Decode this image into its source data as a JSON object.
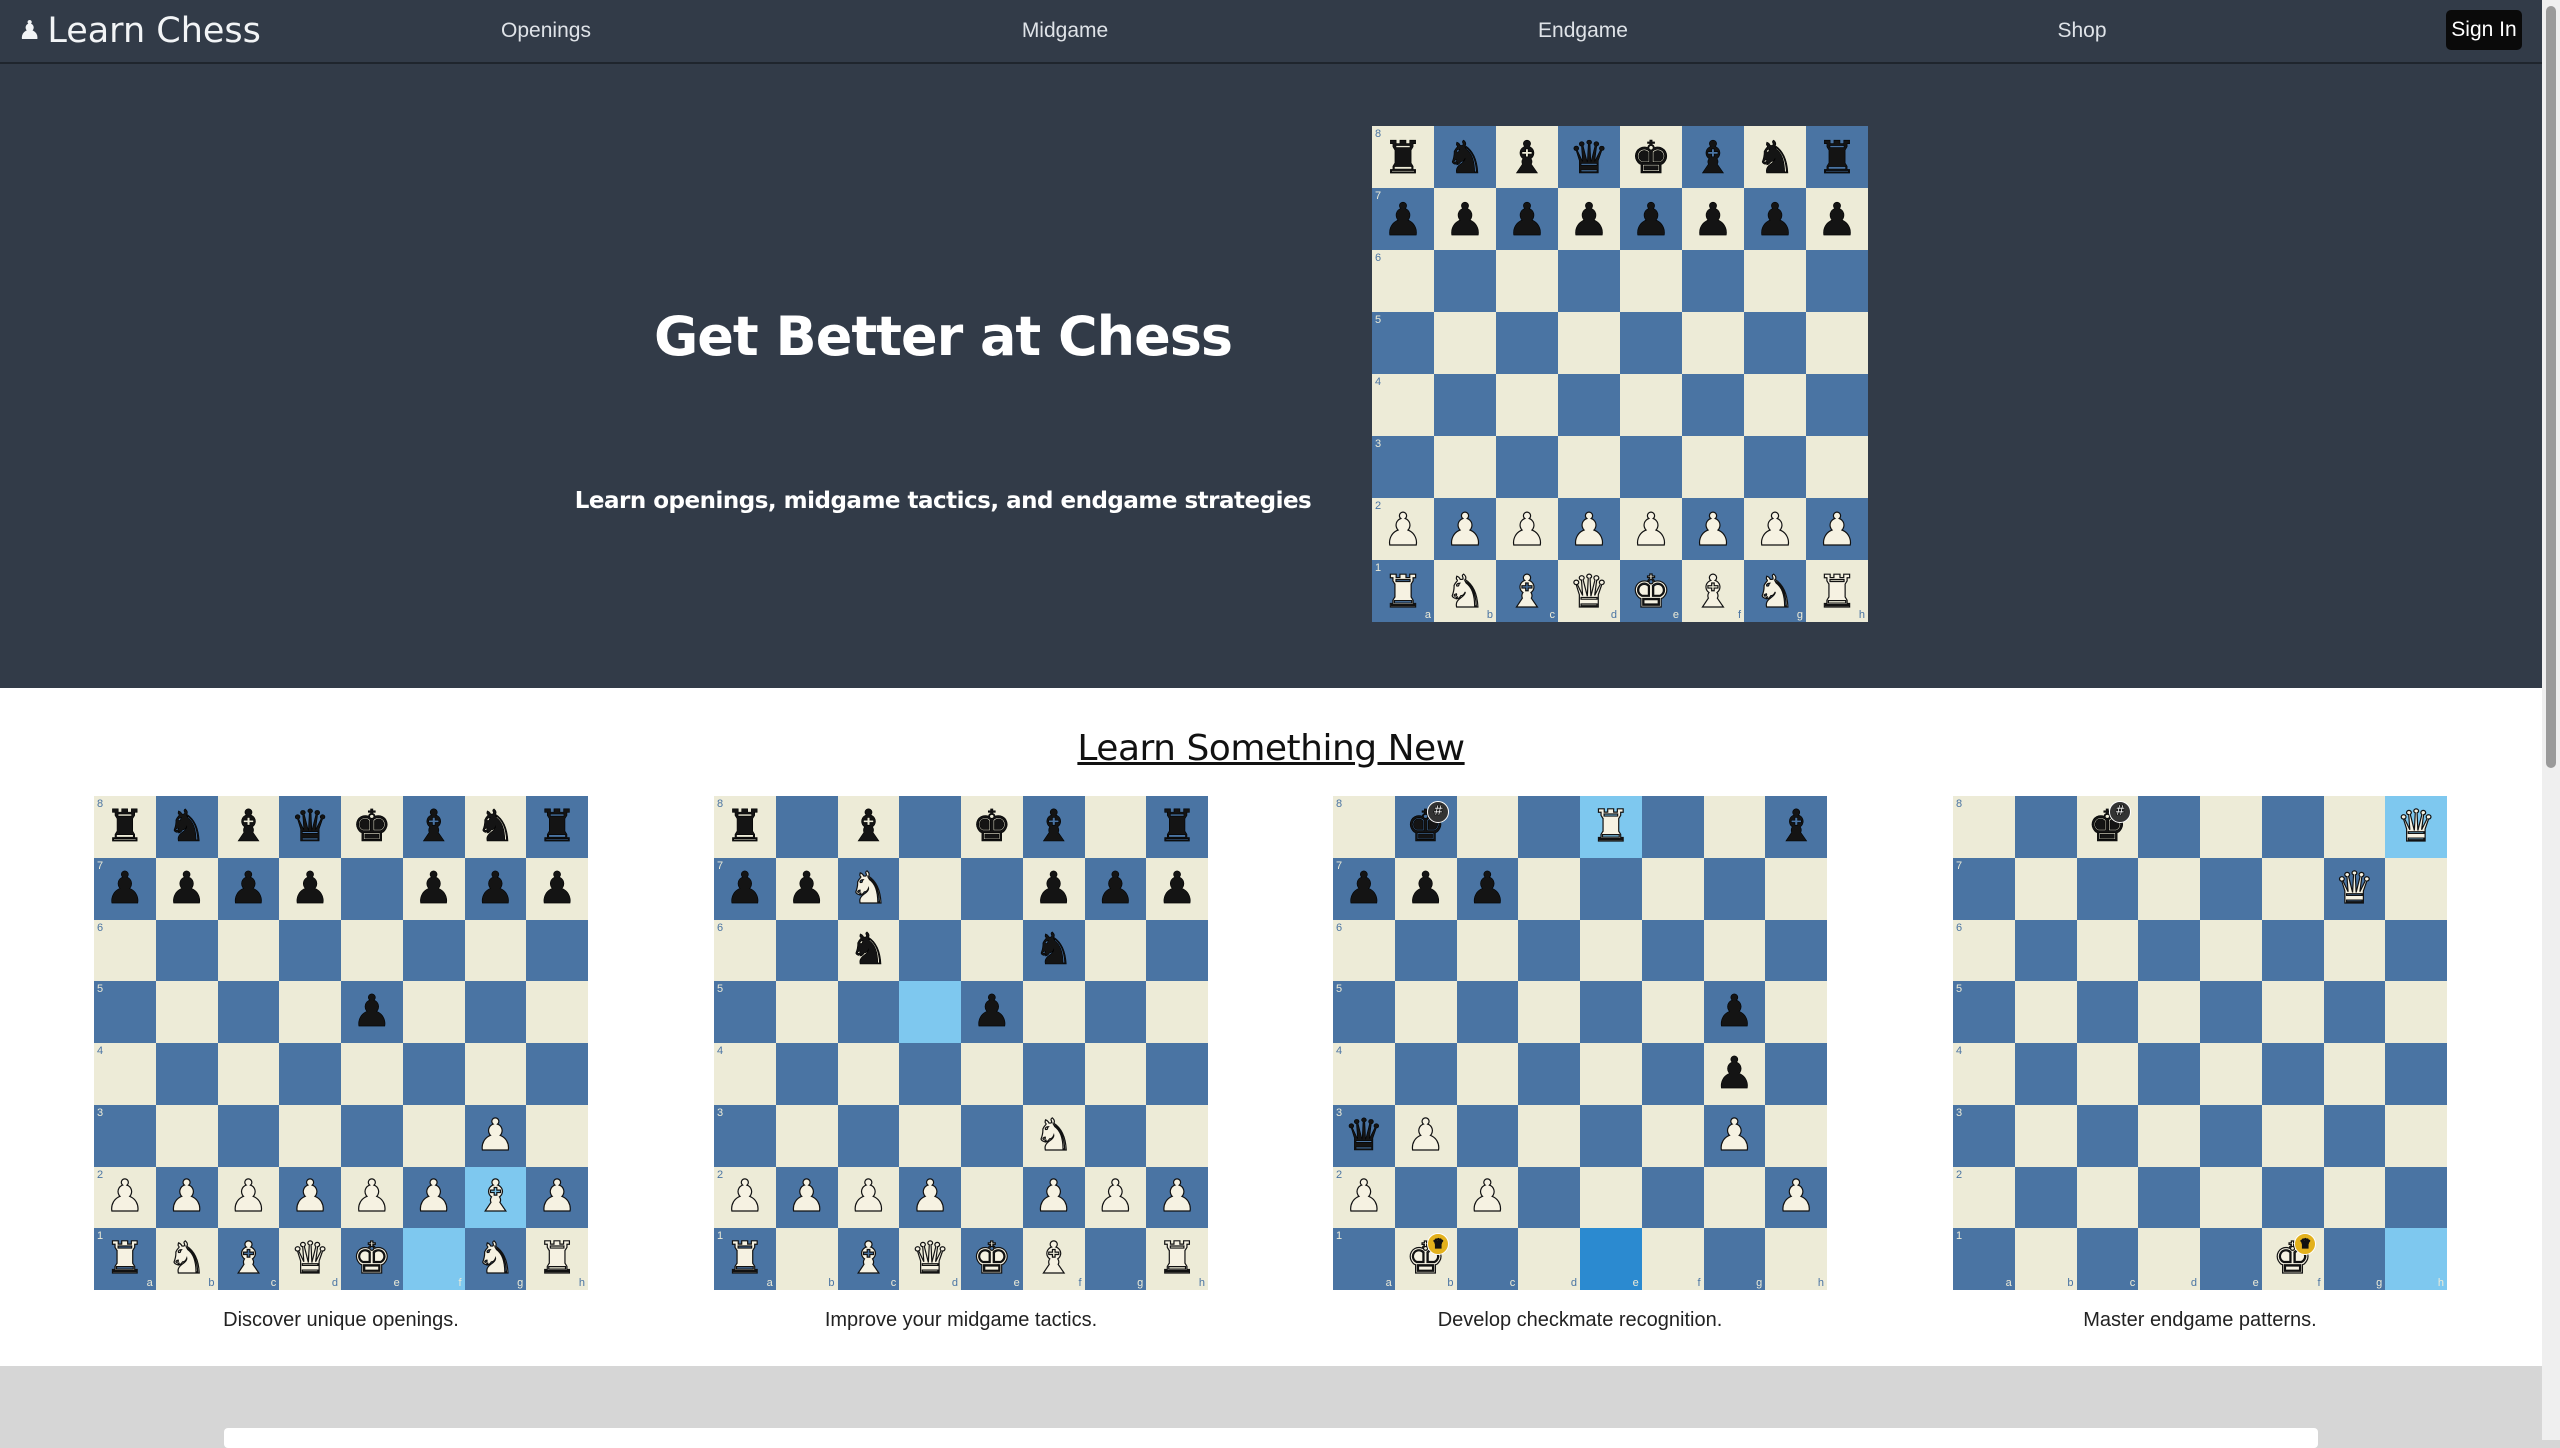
{
  "nav": {
    "brand_icon": "pawn-icon",
    "brand": "Learn Chess",
    "links": [
      "Openings",
      "Midgame",
      "Endgame",
      "Shop"
    ],
    "signin": "Sign In"
  },
  "hero": {
    "title": "Get Better at Chess",
    "subtitle": "Learn openings, midgame tactics, and endgame strategies"
  },
  "section": {
    "title": "Learn Something New"
  },
  "colors": {
    "nav_bg": "#323b48",
    "light_square": "#edebd7",
    "dark_square": "#4a74a3",
    "highlight": "#7ec8ef",
    "highlight_strong": "#2b8ad0",
    "mate_badge": "#333333",
    "win_badge": "#e3b11c"
  },
  "hero_board": {
    "rows": [
      "rnbqkbnr",
      "pppppppp",
      "........",
      "........",
      "........",
      "........",
      "PPPPPPPP",
      "RNBQKBNR"
    ],
    "highlights": {},
    "badges": {}
  },
  "cards": [
    {
      "caption": "Discover unique openings.",
      "rows": [
        "rnbqkbnr",
        "pppp.ppp",
        "........",
        "....p...",
        "........",
        "......P.",
        "PPPPPPBP",
        "RNBQK.NR"
      ],
      "highlights": {
        "6-6": "hl",
        "7-5": "hl"
      },
      "badges": {}
    },
    {
      "caption": "Improve your midgame tactics.",
      "rows": [
        "r.b.kb.r",
        "ppN..ppp",
        "..n..n..",
        "....p...",
        "........",
        ".....N..",
        "PPPP.PPP",
        "R.BQKB.R"
      ],
      "highlights": {
        "3-3": "hl"
      },
      "badges": {}
    },
    {
      "caption": "Develop checkmate recognition.",
      "rows": [
        ".k..R..b",
        "ppp.....",
        "........",
        "......p.",
        "......p.",
        "qP....P.",
        "P.P....P",
        ".K......"
      ],
      "highlights": {
        "0-4": "hl",
        "7-4": "hl2"
      },
      "badges": {
        "0-1": "mate",
        "7-1": "win"
      }
    },
    {
      "caption": "Master endgame patterns.",
      "rows": [
        "..k....Q",
        "......Q.",
        "........",
        "........",
        "........",
        "........",
        "........",
        ".....K.."
      ],
      "highlights": {
        "0-7": "hl",
        "7-7": "hl"
      },
      "badges": {
        "0-2": "mate",
        "7-5": "win"
      }
    }
  ]
}
